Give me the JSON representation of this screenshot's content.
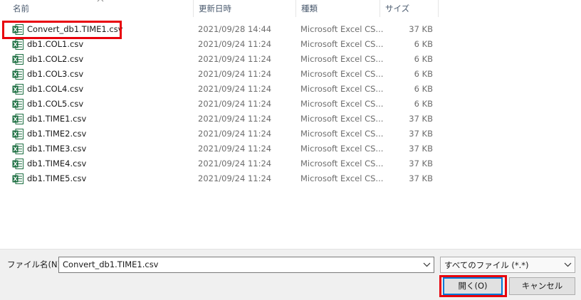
{
  "columns": {
    "name": "名前",
    "date": "更新日時",
    "type": "種類",
    "size": "サイズ"
  },
  "files": [
    {
      "name": "Convert_db1.TIME1.csv",
      "date": "2021/09/28 14:44",
      "type": "Microsoft Excel CS...",
      "size": "37 KB",
      "selected": true
    },
    {
      "name": "db1.COL1.csv",
      "date": "2021/09/24 11:24",
      "type": "Microsoft Excel CS...",
      "size": "6 KB"
    },
    {
      "name": "db1.COL2.csv",
      "date": "2021/09/24 11:24",
      "type": "Microsoft Excel CS...",
      "size": "6 KB"
    },
    {
      "name": "db1.COL3.csv",
      "date": "2021/09/24 11:24",
      "type": "Microsoft Excel CS...",
      "size": "6 KB"
    },
    {
      "name": "db1.COL4.csv",
      "date": "2021/09/24 11:24",
      "type": "Microsoft Excel CS...",
      "size": "6 KB"
    },
    {
      "name": "db1.COL5.csv",
      "date": "2021/09/24 11:24",
      "type": "Microsoft Excel CS...",
      "size": "6 KB"
    },
    {
      "name": "db1.TIME1.csv",
      "date": "2021/09/24 11:24",
      "type": "Microsoft Excel CS...",
      "size": "37 KB"
    },
    {
      "name": "db1.TIME2.csv",
      "date": "2021/09/24 11:24",
      "type": "Microsoft Excel CS...",
      "size": "37 KB"
    },
    {
      "name": "db1.TIME3.csv",
      "date": "2021/09/24 11:24",
      "type": "Microsoft Excel CS...",
      "size": "37 KB"
    },
    {
      "name": "db1.TIME4.csv",
      "date": "2021/09/24 11:24",
      "type": "Microsoft Excel CS...",
      "size": "37 KB"
    },
    {
      "name": "db1.TIME5.csv",
      "date": "2021/09/24 11:24",
      "type": "Microsoft Excel CS...",
      "size": "37 KB"
    }
  ],
  "file_icon": "excel-csv-icon",
  "filename": {
    "label": "ファイル名(N):",
    "value": "Convert_db1.TIME1.csv"
  },
  "filter": {
    "value": "すべてのファイル (*.*)"
  },
  "buttons": {
    "open": "開く(O)",
    "cancel": "キャンセル"
  },
  "colors": {
    "highlight": "#e8000b",
    "excel_green": "#1d6f42",
    "focus_blue": "#0078d7"
  }
}
